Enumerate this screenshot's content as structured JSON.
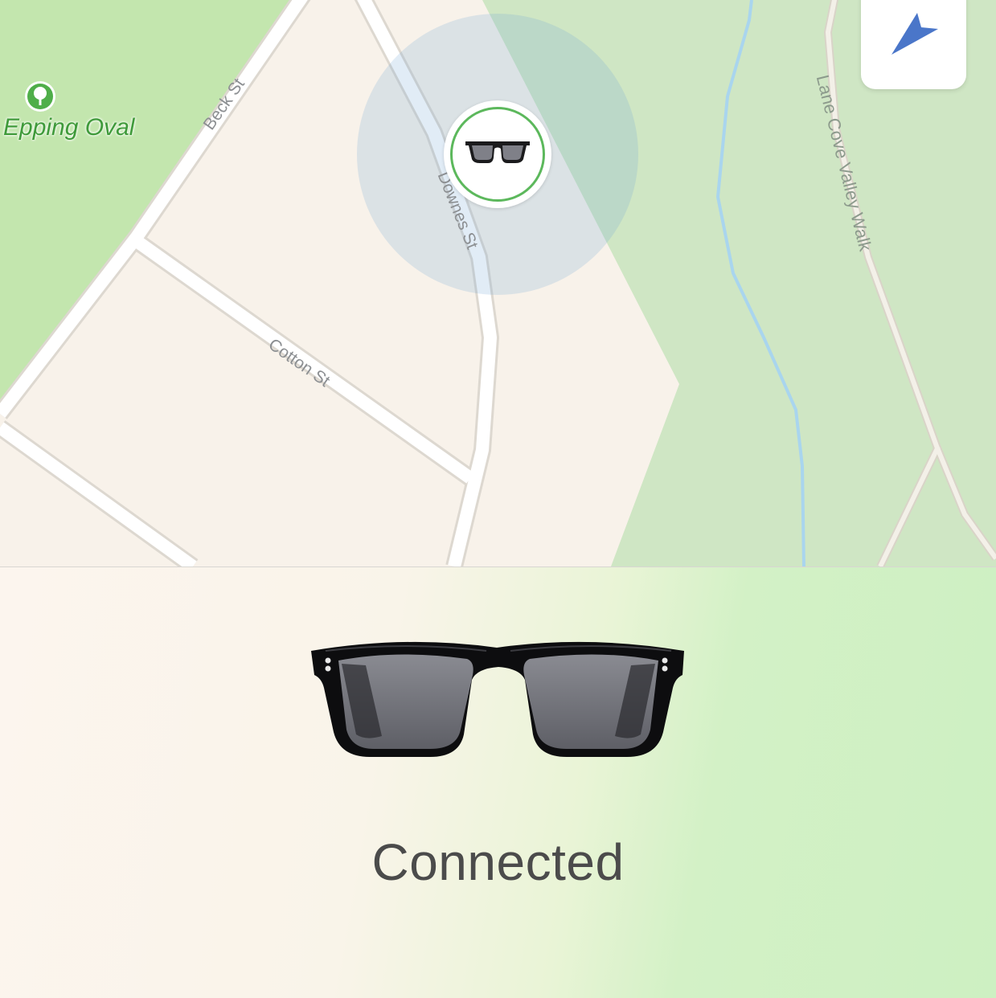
{
  "map": {
    "poi": {
      "name": "Epping Oval",
      "icon": "tree-icon"
    },
    "streets": {
      "beck": "Beck St",
      "downes": "Downes St",
      "cotton": "Cotton St",
      "walk": "Lane Cove Valley Walk"
    },
    "device_marker": {
      "icon": "sunglasses-icon"
    },
    "locate_button": {
      "icon": "location-arrow-icon"
    },
    "colors": {
      "land": "#f8f2ea",
      "park": "#c3e6ae",
      "reserve": "#cfe6c4",
      "road": "#ffffff",
      "water": "#a9d5ee",
      "accent": "#4a76c9",
      "connected_ring": "#5cb85c"
    }
  },
  "status": {
    "label": "Connected",
    "device_image": "sunglasses-icon"
  }
}
